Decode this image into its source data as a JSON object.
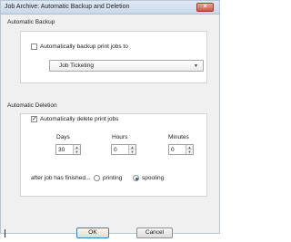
{
  "window": {
    "title": "Job Archive: Automatic Backup and Deletion",
    "close_glyph": "✕"
  },
  "backup": {
    "heading": "Automatic Backup",
    "checkbox_label": "Automatically backup print jobs to",
    "checked": false,
    "destination": "Job Ticketing",
    "dropdown_glyph": "▼"
  },
  "deletion": {
    "heading": "Automatic Deletion",
    "checkbox_label": "Automatically delete print jobs",
    "checked": true,
    "days": {
      "label": "Days",
      "value": "30"
    },
    "hours": {
      "label": "Hours",
      "value": "0"
    },
    "minutes": {
      "label": "Minutes",
      "value": "0"
    },
    "after_label": "after job has finished...",
    "options": [
      {
        "label": "printing",
        "selected": false
      },
      {
        "label": "spooling",
        "selected": true
      }
    ]
  },
  "buttons": {
    "ok": "OK",
    "cancel": "Cancel"
  },
  "spinner_glyphs": {
    "up": "▲",
    "down": "▼"
  }
}
